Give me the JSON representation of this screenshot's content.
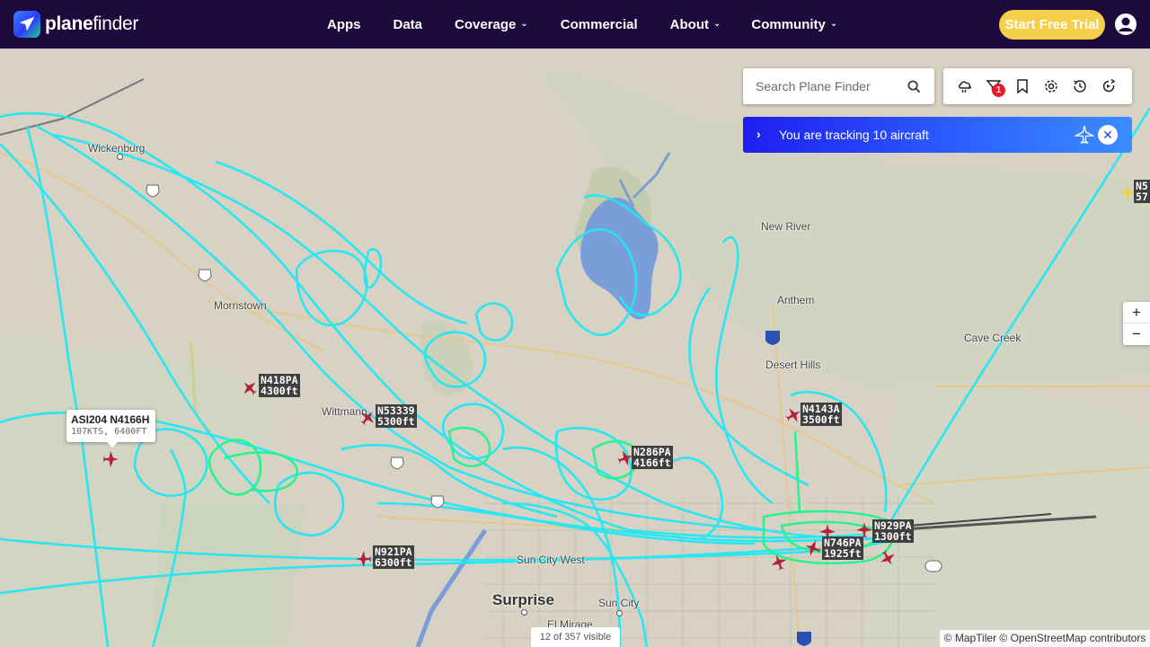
{
  "brand": {
    "name_bold": "plane",
    "name_rest": "finder"
  },
  "nav": {
    "items": [
      {
        "label": "Apps",
        "has_menu": false
      },
      {
        "label": "Data",
        "has_menu": false
      },
      {
        "label": "Coverage",
        "has_menu": true
      },
      {
        "label": "Commercial",
        "has_menu": false
      },
      {
        "label": "About",
        "has_menu": true
      },
      {
        "label": "Community",
        "has_menu": true
      }
    ],
    "cta": "Start Free Trial"
  },
  "search": {
    "placeholder": "Search Plane Finder"
  },
  "toolbar": {
    "icons": [
      "weather-icon",
      "filter-icon",
      "bookmark-icon",
      "settings-icon",
      "history-icon",
      "playback-icon"
    ],
    "filter_badge": "1"
  },
  "tracking": {
    "text": "You are tracking 10 aircraft"
  },
  "zoom": {
    "in": "+",
    "out": "−"
  },
  "status": {
    "visible": "12 of 357 visible"
  },
  "attribution": "© MapTiler © OpenStreetMap contributors",
  "places": [
    {
      "name": "Wickenburg",
      "big": false
    },
    {
      "name": "New River",
      "big": false
    },
    {
      "name": "Anthem",
      "big": false
    },
    {
      "name": "Morristown",
      "big": false
    },
    {
      "name": "Desert Hills",
      "big": false
    },
    {
      "name": "Cave Creek",
      "big": false
    },
    {
      "name": "Wittmann",
      "big": false
    },
    {
      "name": "Surprise",
      "big": true
    },
    {
      "name": "Sun City",
      "big": false
    },
    {
      "name": "Sun City West",
      "big": false
    },
    {
      "name": "El Mirage",
      "big": false
    }
  ],
  "popup": {
    "title": "ASI204 N4166H",
    "detail": "107KTS, 6400FT"
  },
  "aircraft": [
    {
      "callsign": "N418PA",
      "alt": "4300ft"
    },
    {
      "callsign": "N53339",
      "alt": "5300ft"
    },
    {
      "callsign": "N4143A",
      "alt": "3500ft"
    },
    {
      "callsign": "N286PA",
      "alt": "4166ft"
    },
    {
      "callsign": "N929PA",
      "alt": "1300ft"
    },
    {
      "callsign": "N746PA",
      "alt": "1925ft"
    },
    {
      "callsign": "N921PA",
      "alt": "6300ft"
    },
    {
      "callsign": "N5",
      "alt": "57"
    }
  ],
  "colors": {
    "nav_bg": "#1c0a3d",
    "cta": "#f5cf4a",
    "track_cyan": "#1fe8f5",
    "track_green": "#22f58a",
    "aircraft": "#b0233a",
    "label_bg": "#3f3f3f",
    "tracking_bar": "#2637ff"
  }
}
